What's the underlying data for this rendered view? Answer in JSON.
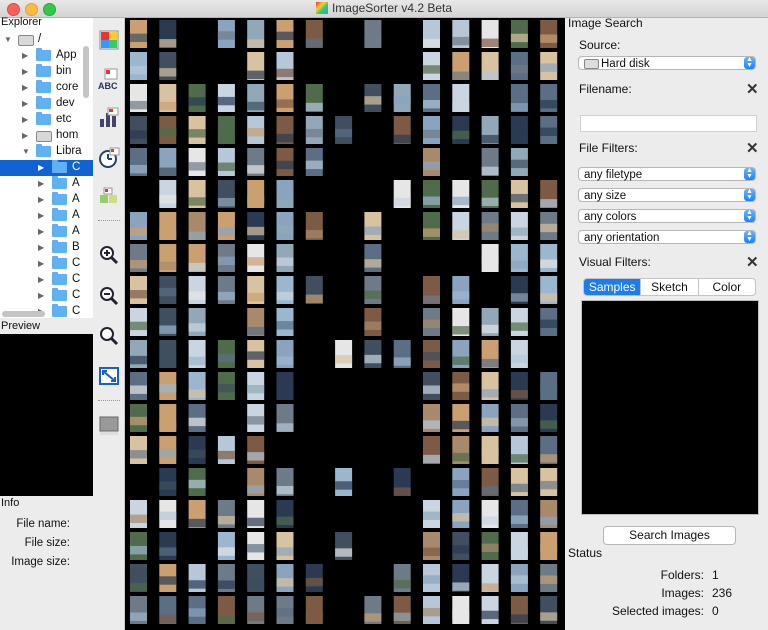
{
  "window": {
    "title": "ImageSorter v4.2 Beta"
  },
  "explorer": {
    "header": "Explorer",
    "tree": [
      {
        "label": "/",
        "icon": "drive-icon",
        "depth": 0,
        "expanded": true
      },
      {
        "label": "App",
        "icon": "folder-icon",
        "depth": 1
      },
      {
        "label": "bin",
        "icon": "folder-icon",
        "depth": 1
      },
      {
        "label": "core",
        "icon": "folder-icon",
        "depth": 1
      },
      {
        "label": "dev",
        "icon": "folder-icon",
        "depth": 1
      },
      {
        "label": "etc",
        "icon": "folder-icon",
        "depth": 1
      },
      {
        "label": "hom",
        "icon": "drive-icon",
        "depth": 1
      },
      {
        "label": "Libra",
        "icon": "folder-icon",
        "depth": 1,
        "expanded": true
      },
      {
        "label": "C",
        "icon": "folder-icon",
        "depth": 2,
        "selected": true
      },
      {
        "label": "A",
        "icon": "folder-icon",
        "depth": 2
      },
      {
        "label": "A",
        "icon": "folder-icon",
        "depth": 2
      },
      {
        "label": "A",
        "icon": "folder-icon",
        "depth": 2
      },
      {
        "label": "A",
        "icon": "folder-icon",
        "depth": 2
      },
      {
        "label": "B",
        "icon": "folder-icon",
        "depth": 2
      },
      {
        "label": "C",
        "icon": "folder-icon",
        "depth": 2
      },
      {
        "label": "C",
        "icon": "folder-icon",
        "depth": 2
      },
      {
        "label": "C",
        "icon": "folder-icon",
        "depth": 2
      },
      {
        "label": "C",
        "icon": "folder-icon",
        "depth": 2
      }
    ]
  },
  "preview": {
    "header": "Preview"
  },
  "info": {
    "header": "Info",
    "file_name_label": "File name:",
    "file_size_label": "File size:",
    "image_size_label": "Image size:"
  },
  "toolbar": {
    "tools": [
      "sort-by-color-icon",
      "sort-by-name-icon",
      "sort-by-size-icon",
      "sort-by-date-icon",
      "sort-similar-icon",
      "zoom-in-icon",
      "zoom-out-icon",
      "search-zoom-icon",
      "fit-to-window-icon",
      "background-color-icon"
    ]
  },
  "search": {
    "header": "Image Search",
    "source_label": "Source:",
    "source_value": "Hard disk",
    "filename_label": "Filename:",
    "filename_value": "",
    "file_filters_label": "File Filters:",
    "filter_filetype": "any filetype",
    "filter_size": "any size",
    "filter_colors": "any colors",
    "filter_orientation": "any orientation",
    "visual_filters_label": "Visual Filters:",
    "tabs": [
      "Samples",
      "Sketch",
      "Color"
    ],
    "active_tab": "Samples",
    "search_button": "Search Images"
  },
  "status": {
    "header": "Status",
    "folders_label": "Folders:",
    "folders_value": "1",
    "images_label": "Images:",
    "images_value": "236",
    "selected_label": "Selected images:",
    "selected_value": "0"
  },
  "colors": {
    "accent": "#1d7cf2",
    "selection": "#0f63d3",
    "folder": "#5fb1f3",
    "canvas_bg": "#000000"
  }
}
